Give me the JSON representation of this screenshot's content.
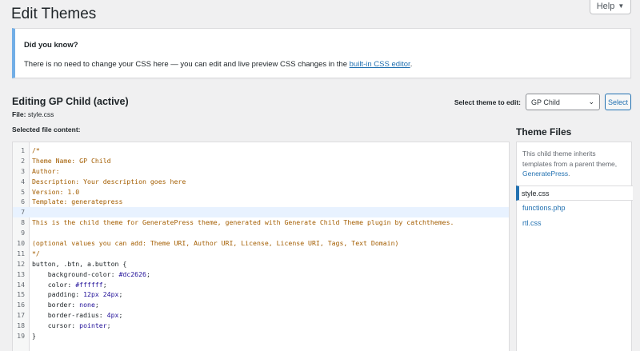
{
  "page": {
    "title": "Edit Themes",
    "help_label": "Help"
  },
  "notice": {
    "title": "Did you know?",
    "text_before": "There is no need to change your CSS here — you can edit and live preview CSS changes in the ",
    "link": "built-in CSS editor",
    "text_after": "."
  },
  "editing": {
    "title": "Editing GP Child (active)",
    "file_label": "File: ",
    "file_name": "style.css",
    "selected_label": "Selected file content:"
  },
  "theme_select": {
    "label": "Select theme to edit:",
    "value": "GP Child",
    "button": "Select"
  },
  "code": {
    "lines": [
      {
        "n": "1",
        "t": "/*",
        "k": "comment"
      },
      {
        "n": "2",
        "t": "Theme Name: GP Child",
        "k": "comment"
      },
      {
        "n": "3",
        "t": "Author:",
        "k": "comment"
      },
      {
        "n": "4",
        "t": "Description: Your description goes here",
        "k": "comment"
      },
      {
        "n": "5",
        "t": "Version: 1.0",
        "k": "comment"
      },
      {
        "n": "6",
        "t": "Template: generatepress",
        "k": "comment"
      },
      {
        "n": "7",
        "t": "",
        "k": "comment",
        "active": true
      },
      {
        "n": "8",
        "t": "This is the child theme for GeneratePress theme, generated with Generate Child Theme plugin by catchthemes.",
        "k": "comment"
      },
      {
        "n": "9",
        "t": "",
        "k": "comment"
      },
      {
        "n": "10",
        "t": "(optional values you can add: Theme URI, Author URI, License, License URI, Tags, Text Domain)",
        "k": "comment"
      },
      {
        "n": "11",
        "t": "*/",
        "k": "comment"
      },
      {
        "n": "12",
        "t": "button, .btn, a.button {",
        "k": "sel"
      },
      {
        "n": "13",
        "p": "    background-color: ",
        "v": "#dc2626",
        "e": ";",
        "k": "decl"
      },
      {
        "n": "14",
        "p": "    color: ",
        "v": "#ffffff",
        "e": ";",
        "k": "decl"
      },
      {
        "n": "15",
        "p": "    padding: ",
        "v": "12px 24px",
        "e": ";",
        "k": "decl"
      },
      {
        "n": "16",
        "p": "    border: ",
        "v": "none",
        "e": ";",
        "k": "decl"
      },
      {
        "n": "17",
        "p": "    border-radius: ",
        "v": "4px",
        "e": ";",
        "k": "decl"
      },
      {
        "n": "18",
        "p": "    cursor: ",
        "v": "pointer",
        "e": ";",
        "k": "decl"
      },
      {
        "n": "19",
        "t": "}",
        "k": "sel"
      }
    ]
  },
  "theme_files": {
    "title": "Theme Files",
    "desc_before": "This child theme inherits templates from a parent theme, ",
    "desc_link": "GeneratePress",
    "desc_after": ".",
    "files": [
      {
        "name": "style.css",
        "current": true
      },
      {
        "name": "functions.php",
        "current": false
      },
      {
        "name": "rtl.css",
        "current": false
      }
    ]
  },
  "colors": {
    "accent": "#2271b1",
    "notice_border": "#72aee6",
    "comment": "#a35d00",
    "value": "#221199",
    "active_line": "#e8f2ff"
  }
}
